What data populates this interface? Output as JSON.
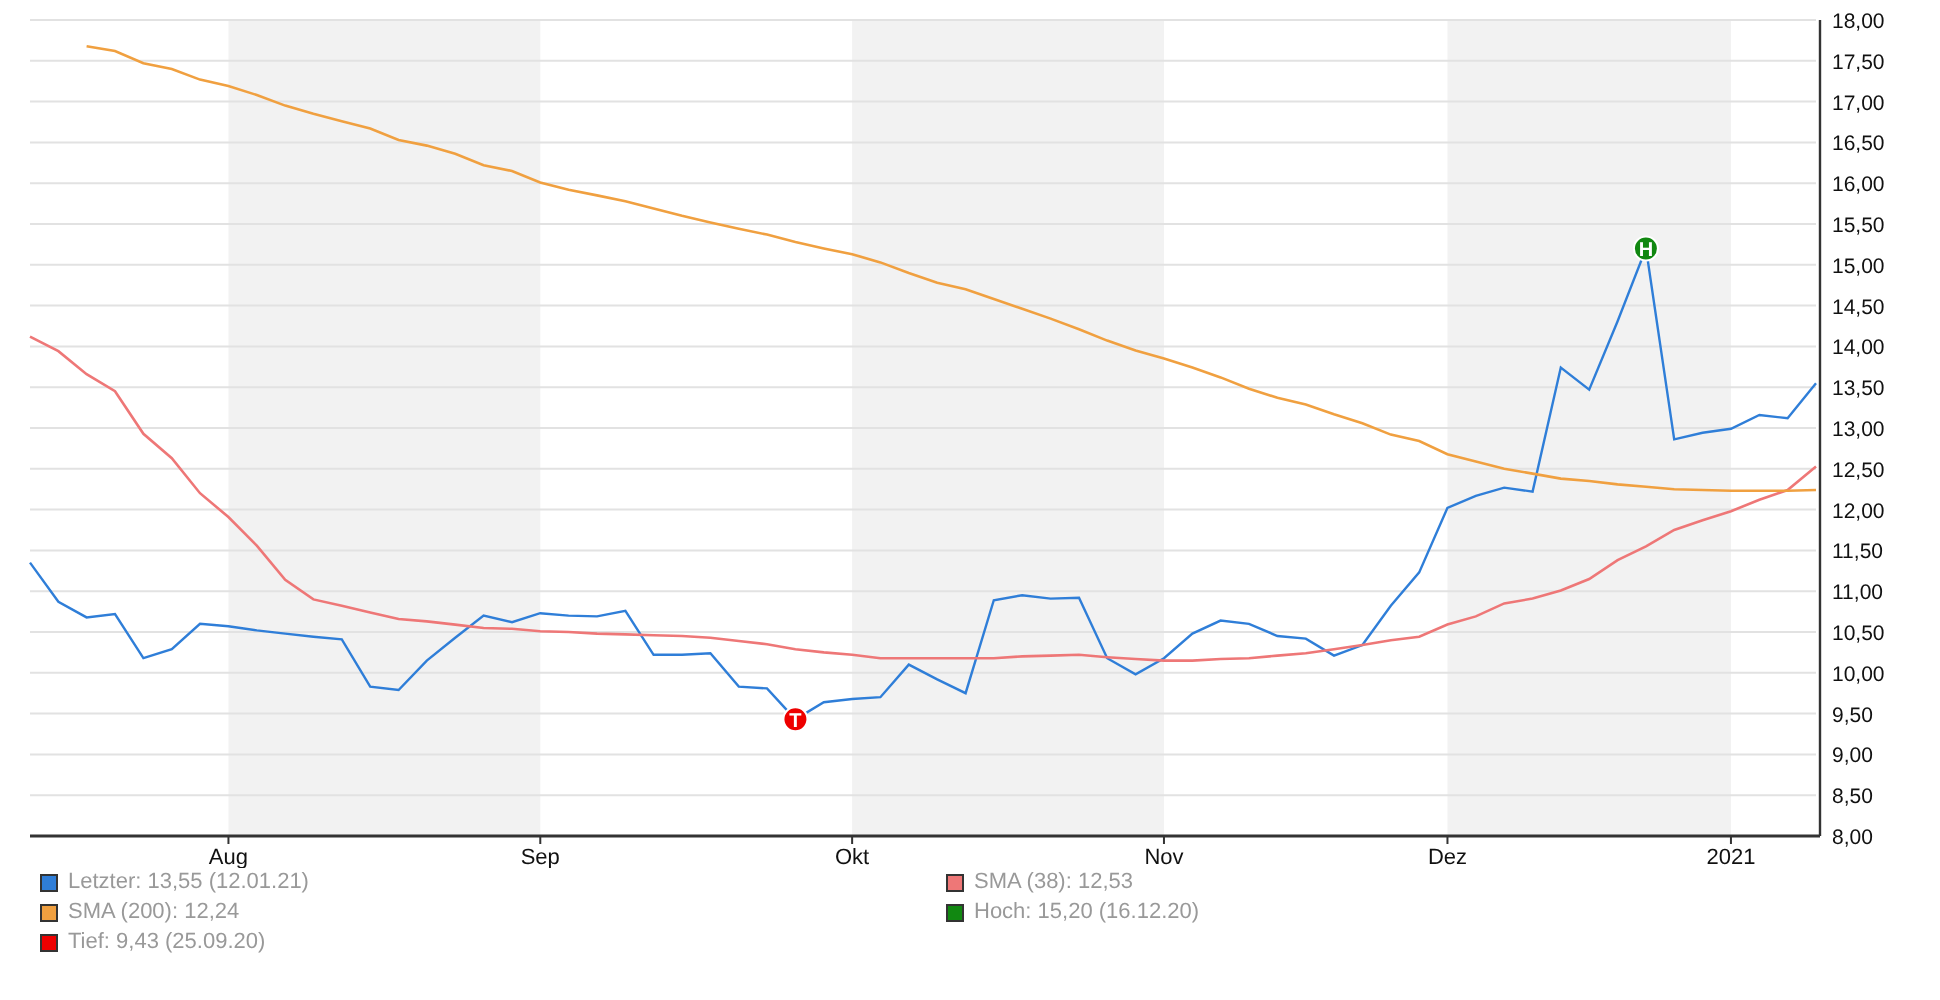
{
  "chart_data": {
    "type": "line",
    "ylim": [
      8,
      18
    ],
    "grid": true,
    "categories": [
      null,
      null,
      null,
      null,
      null,
      null,
      null,
      "Aug",
      null,
      null,
      null,
      null,
      null,
      null,
      null,
      null,
      null,
      null,
      "Sep",
      null,
      null,
      null,
      null,
      null,
      null,
      null,
      null,
      null,
      null,
      "Okt",
      null,
      null,
      null,
      null,
      null,
      null,
      null,
      null,
      null,
      null,
      "Nov",
      null,
      null,
      null,
      null,
      null,
      null,
      null,
      null,
      null,
      "Dez",
      null,
      null,
      null,
      null,
      null,
      null,
      null,
      null,
      null,
      "2021",
      null,
      null,
      null
    ],
    "series": [
      {
        "name": "Letzter",
        "color": "#2f7ed8",
        "values": [
          11.35,
          10.87,
          10.68,
          10.72,
          10.18,
          10.29,
          10.6,
          10.57,
          10.52,
          10.48,
          10.44,
          10.41,
          9.83,
          9.79,
          10.15,
          10.43,
          10.7,
          10.62,
          10.73,
          10.7,
          10.69,
          10.76,
          10.22,
          10.22,
          10.24,
          9.83,
          9.81,
          9.43,
          9.64,
          9.68,
          9.7,
          10.1,
          9.92,
          9.75,
          10.89,
          10.95,
          10.91,
          10.92,
          10.18,
          9.98,
          10.18,
          10.48,
          10.64,
          10.6,
          10.45,
          10.42,
          10.21,
          10.34,
          10.82,
          11.23,
          12.02,
          12.17,
          12.27,
          12.22,
          13.74,
          13.47,
          14.31,
          15.2,
          12.86,
          12.94,
          12.99,
          13.16,
          13.12,
          13.55
        ]
      },
      {
        "name": "SMA (38)",
        "color": "#ee7777",
        "values": [
          14.12,
          13.94,
          13.66,
          13.45,
          12.93,
          12.63,
          12.2,
          11.91,
          11.56,
          11.14,
          10.9,
          10.82,
          10.74,
          10.66,
          10.63,
          10.59,
          10.55,
          10.54,
          10.51,
          10.5,
          10.48,
          10.47,
          10.46,
          10.45,
          10.43,
          10.39,
          10.35,
          10.29,
          10.25,
          10.22,
          10.18,
          10.18,
          10.18,
          10.18,
          10.18,
          10.2,
          10.21,
          10.22,
          10.19,
          10.17,
          10.15,
          10.15,
          10.17,
          10.18,
          10.21,
          10.24,
          10.29,
          10.34,
          10.4,
          10.44,
          10.59,
          10.69,
          10.85,
          10.91,
          11.01,
          11.15,
          11.38,
          11.55,
          11.75,
          11.87,
          11.98,
          12.12,
          12.24,
          12.53
        ]
      },
      {
        "name": "SMA (200)",
        "color": "#f0a040",
        "values": [
          null,
          null,
          17.68,
          17.62,
          17.47,
          17.4,
          17.27,
          17.19,
          17.08,
          16.95,
          16.85,
          16.76,
          16.67,
          16.53,
          16.46,
          16.36,
          16.22,
          16.15,
          16.01,
          15.92,
          15.85,
          15.78,
          15.69,
          15.6,
          15.52,
          15.44,
          15.37,
          15.28,
          15.2,
          15.13,
          15.03,
          14.9,
          14.78,
          14.7,
          14.58,
          14.46,
          14.34,
          14.21,
          14.07,
          13.95,
          13.85,
          13.74,
          13.62,
          13.48,
          13.37,
          13.29,
          13.17,
          13.06,
          12.92,
          12.84,
          12.68,
          12.59,
          12.5,
          12.44,
          12.38,
          12.35,
          12.31,
          12.28,
          12.25,
          12.24,
          12.23,
          12.23,
          12.23,
          12.24
        ]
      }
    ],
    "yticks": [
      {
        "value": 8,
        "label": "8,00"
      },
      {
        "value": 8.5,
        "label": "8,50"
      },
      {
        "value": 9,
        "label": "9,00"
      },
      {
        "value": 9.5,
        "label": "9,50"
      },
      {
        "value": 10,
        "label": "10,00"
      },
      {
        "value": 10.5,
        "label": "10,50"
      },
      {
        "value": 11,
        "label": "11,00"
      },
      {
        "value": 11.5,
        "label": "11,50"
      },
      {
        "value": 12,
        "label": "12,00"
      },
      {
        "value": 12.5,
        "label": "12,50"
      },
      {
        "value": 13,
        "label": "13,00"
      },
      {
        "value": 13.5,
        "label": "13,50"
      },
      {
        "value": 14,
        "label": "14,00"
      },
      {
        "value": 14.5,
        "label": "14,50"
      },
      {
        "value": 15,
        "label": "15,00"
      },
      {
        "value": 15.5,
        "label": "15,50"
      },
      {
        "value": 16,
        "label": "16,00"
      },
      {
        "value": 16.5,
        "label": "16,50"
      },
      {
        "value": 17,
        "label": "17,00"
      },
      {
        "value": 17.5,
        "label": "17,50"
      },
      {
        "value": 18,
        "label": "18,00"
      }
    ],
    "annotations": [
      {
        "y": 9.43,
        "text": "T"
      },
      {
        "y": 15.2,
        "text": "H"
      }
    ]
  },
  "legend": [
    {
      "kind": "series",
      "value": ": 13,55 (12.01.21)"
    },
    {
      "kind": "series",
      "value": ": 12,53"
    },
    {
      "kind": "series",
      "value": ": 12,24"
    },
    {
      "label": "Hoch: 15,20 (16.12.20)",
      "color": "#118811"
    },
    {
      "label": "Tief: 9,43 (25.09.20)",
      "color": "#ee0000"
    }
  ]
}
